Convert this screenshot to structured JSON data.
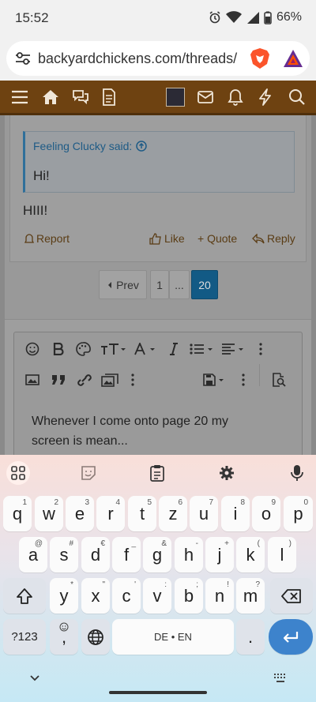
{
  "status": {
    "time": "15:52",
    "battery": "66%"
  },
  "browser": {
    "url": "backyardchickens.com/threads/"
  },
  "post": {
    "quote_author": "Feeling Clucky said:",
    "quote_text": "Hi!",
    "message": "HIII!",
    "actions": {
      "report": "Report",
      "like": "Like",
      "quote": "+ Quote",
      "reply": "Reply"
    }
  },
  "pagination": {
    "prev": "Prev",
    "first": "1",
    "ellipsis": "...",
    "current": "20"
  },
  "editor": {
    "text": "Whenever I come onto page 20 my screen is mean..."
  },
  "keyboard": {
    "row1": [
      {
        "k": "q",
        "h": "1"
      },
      {
        "k": "w",
        "h": "2"
      },
      {
        "k": "e",
        "h": "3"
      },
      {
        "k": "r",
        "h": "4"
      },
      {
        "k": "t",
        "h": "5"
      },
      {
        "k": "z",
        "h": "6"
      },
      {
        "k": "u",
        "h": "7"
      },
      {
        "k": "i",
        "h": "8"
      },
      {
        "k": "o",
        "h": "9"
      },
      {
        "k": "p",
        "h": "0"
      }
    ],
    "row2": [
      {
        "k": "a",
        "h": "@"
      },
      {
        "k": "s",
        "h": "#"
      },
      {
        "k": "d",
        "h": "€"
      },
      {
        "k": "f",
        "h": "_"
      },
      {
        "k": "g",
        "h": "&"
      },
      {
        "k": "h",
        "h": "-"
      },
      {
        "k": "j",
        "h": "+"
      },
      {
        "k": "k",
        "h": "("
      },
      {
        "k": "l",
        "h": ")"
      }
    ],
    "row3": [
      {
        "k": "y",
        "h": "*"
      },
      {
        "k": "x",
        "h": "\""
      },
      {
        "k": "c",
        "h": "'"
      },
      {
        "k": "v",
        "h": ":"
      },
      {
        "k": "b",
        "h": ";"
      },
      {
        "k": "n",
        "h": "!"
      },
      {
        "k": "m",
        "h": "?"
      }
    ],
    "symbols_label": "?123",
    "comma": ",",
    "space_label": "DE • EN",
    "period": "."
  },
  "colors": {
    "nav_brown": "#6e4211",
    "link_blue": "#1e5b86",
    "page_current": "#125a85",
    "enter_blue": "#3d83cc"
  }
}
